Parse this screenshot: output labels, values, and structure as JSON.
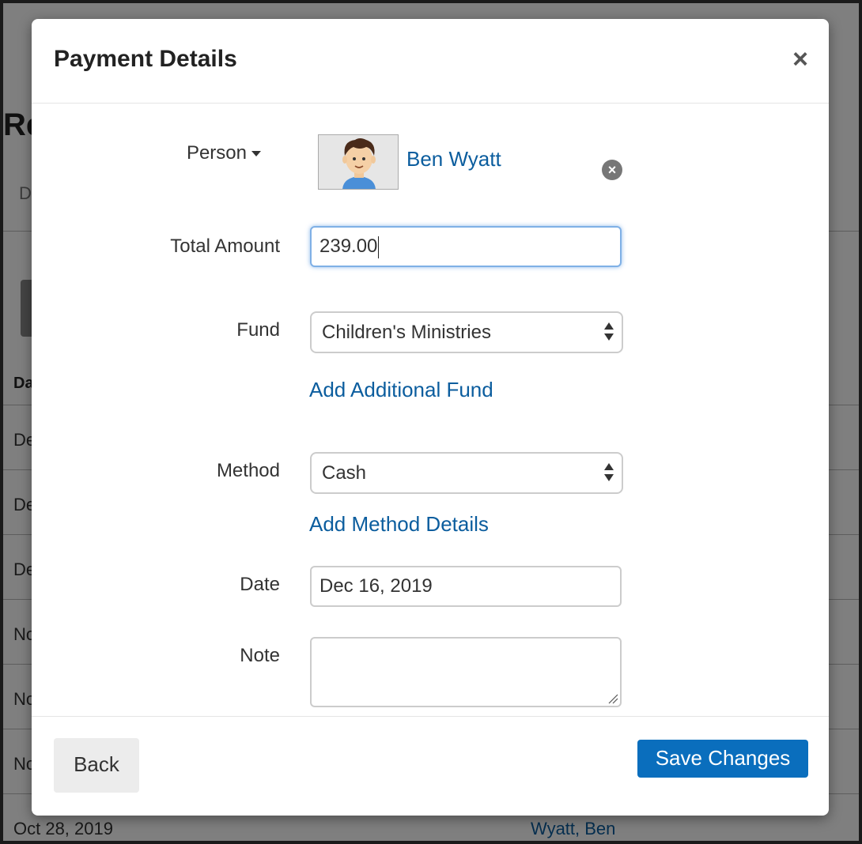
{
  "background": {
    "title": "Re",
    "tab": "D",
    "column_header": "Da",
    "rows": [
      "De",
      "De",
      "De",
      "No",
      "No",
      "No",
      "Oct 28, 2019"
    ],
    "last_row_link": "Wyatt, Ben"
  },
  "modal": {
    "title": "Payment Details",
    "close_label": "×"
  },
  "form": {
    "person_label": "Person",
    "person_name": "Ben Wyatt",
    "total_amount_label": "Total Amount",
    "total_amount_value": "239.00",
    "fund_label": "Fund",
    "fund_value": "Children's Ministries",
    "add_fund_link": "Add Additional Fund",
    "method_label": "Method",
    "method_value": "Cash",
    "add_method_link": "Add Method Details",
    "date_label": "Date",
    "date_value": "Dec 16, 2019",
    "note_label": "Note",
    "note_value": ""
  },
  "footer": {
    "back_label": "Back",
    "save_label": "Save Changes"
  },
  "colors": {
    "link": "#0b5d9e",
    "primary_button": "#0a6ebd",
    "focus_ring": "#7fb0e6"
  },
  "icons": {
    "close": "close-icon",
    "remove": "remove-circle-icon",
    "caret": "caret-down-icon"
  }
}
